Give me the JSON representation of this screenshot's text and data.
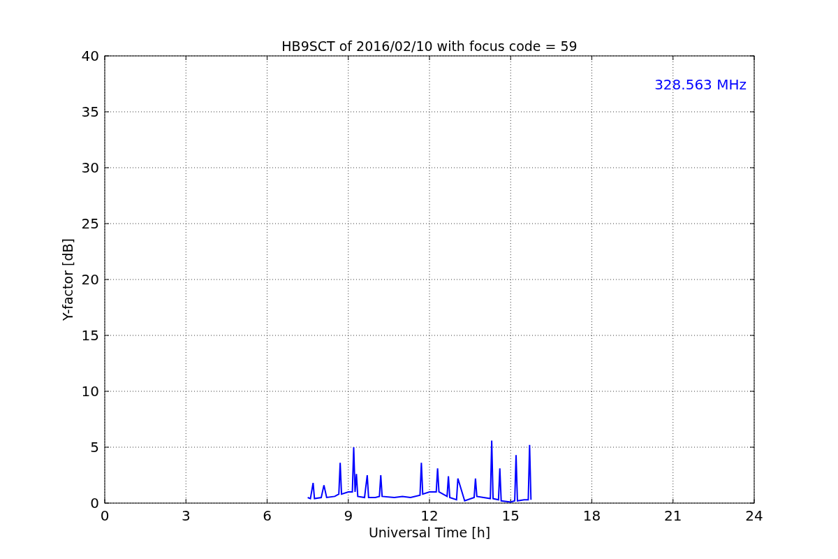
{
  "chart_data": {
    "type": "line",
    "title": "HB9SCT of 2016/02/10 with focus code = 59",
    "xlabel": "Universal Time [h]",
    "ylabel": "Y-factor [dB]",
    "xlim": [
      0,
      24
    ],
    "ylim": [
      0,
      40
    ],
    "xticks": [
      0,
      3,
      6,
      9,
      12,
      15,
      18,
      21,
      24
    ],
    "yticks": [
      0,
      5,
      10,
      15,
      20,
      25,
      30,
      35,
      40
    ],
    "x": [
      7.5,
      7.6,
      7.7,
      7.75,
      8.0,
      8.1,
      8.2,
      8.5,
      8.65,
      8.7,
      8.75,
      9.0,
      9.15,
      9.2,
      9.25,
      9.3,
      9.35,
      9.6,
      9.7,
      9.75,
      10.0,
      10.15,
      10.2,
      10.25,
      10.7,
      11.0,
      11.3,
      11.65,
      11.7,
      11.75,
      12.0,
      12.25,
      12.3,
      12.35,
      12.65,
      12.7,
      12.75,
      13.0,
      13.05,
      13.3,
      13.65,
      13.7,
      13.75,
      14.0,
      14.25,
      14.3,
      14.35,
      14.55,
      14.6,
      14.65,
      15.0,
      15.15,
      15.2,
      15.25,
      15.5,
      15.65,
      15.7,
      15.75
    ],
    "grid": true,
    "series": [
      {
        "color": "#0000ff",
        "values": [
          0.5,
          0.4,
          1.8,
          0.4,
          0.5,
          1.6,
          0.5,
          0.6,
          0.8,
          3.6,
          0.8,
          1.0,
          1.0,
          5.0,
          1.0,
          2.6,
          0.6,
          0.5,
          2.5,
          0.5,
          0.5,
          0.6,
          2.5,
          0.6,
          0.5,
          0.6,
          0.5,
          0.7,
          3.6,
          0.8,
          1.0,
          1.0,
          3.1,
          1.0,
          0.6,
          2.4,
          0.5,
          0.3,
          2.2,
          0.2,
          0.5,
          2.2,
          0.6,
          0.5,
          0.4,
          5.6,
          0.4,
          0.3,
          3.1,
          0.2,
          0.1,
          0.2,
          4.3,
          0.2,
          0.3,
          0.3,
          5.2,
          0.3
        ]
      }
    ],
    "annotations": [
      {
        "text": "328.563 MHz"
      }
    ]
  }
}
